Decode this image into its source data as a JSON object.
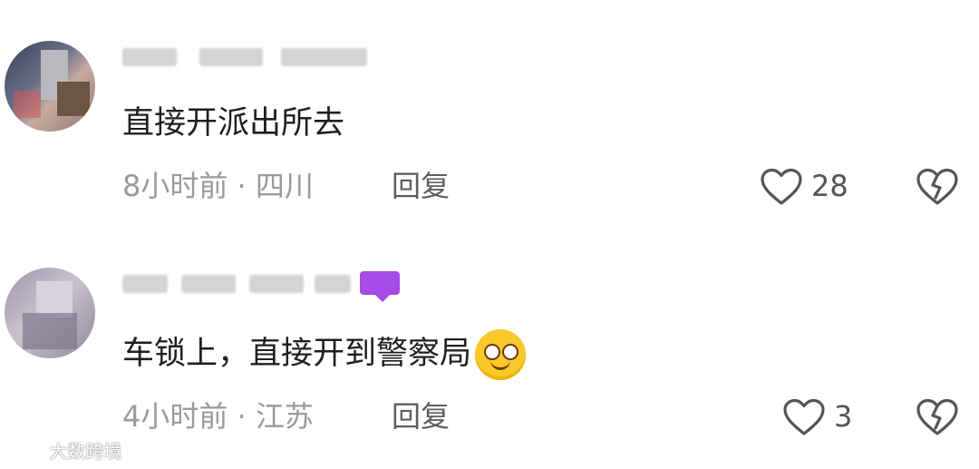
{
  "comments": [
    {
      "text": "直接开派出所去",
      "time_location": "8小时前 · 四川",
      "reply_label": "回复",
      "likes": "28"
    },
    {
      "text": "车锁上，直接开到警察局",
      "time_location": "4小时前 · 江苏",
      "reply_label": "回复",
      "likes": "3"
    }
  ],
  "watermark": {
    "text": "大数跨境"
  },
  "icons": {
    "like": "heart-outline-icon",
    "dislike": "broken-heart-icon",
    "emoji": "grinning-face-icon"
  },
  "colors": {
    "text": "#1f1f1f",
    "meta": "#9a9a9a",
    "reply": "#5e5e5e",
    "tag": "#a44be8"
  }
}
